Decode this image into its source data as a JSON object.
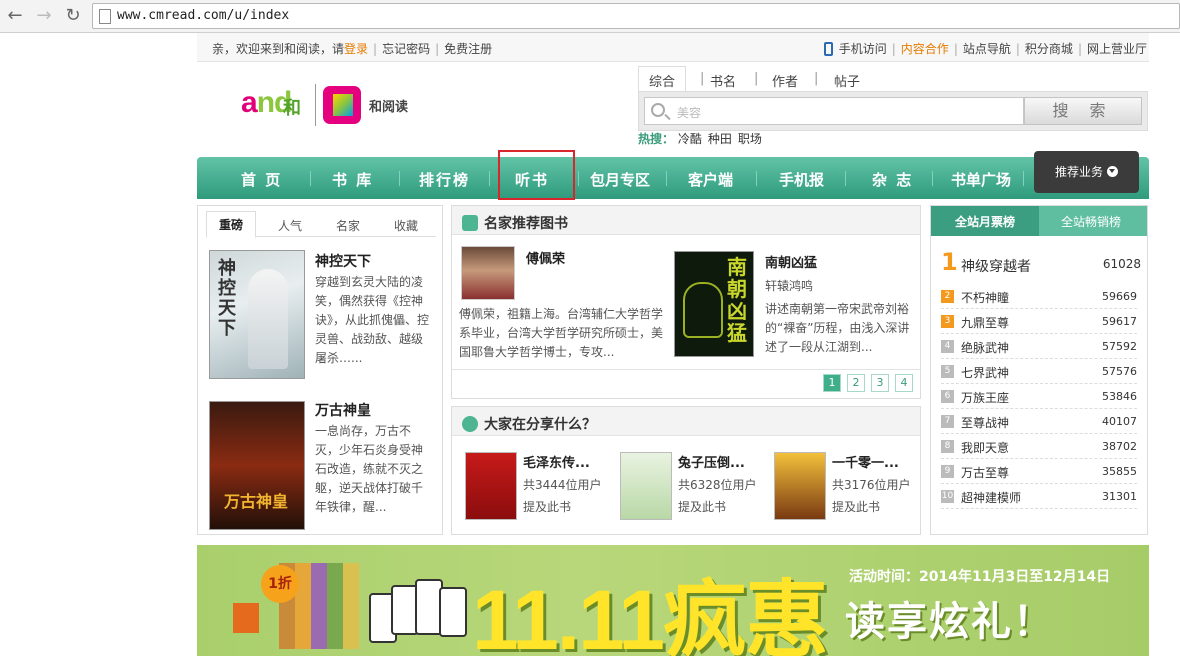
{
  "browser": {
    "url": "www.cmread.com/u/index"
  },
  "topbar": {
    "greeting": "亲，欢迎来到和阅读，请",
    "login": "登录",
    "forgot": "忘记密码",
    "register": "免费注册",
    "links": [
      "手机访问",
      "内容合作",
      "站点导航",
      "积分商城",
      "网上营业厅"
    ]
  },
  "logo": {
    "and": "and",
    "he": "和",
    "name": "和阅读"
  },
  "search": {
    "tabs": [
      "综合",
      "书名",
      "作者",
      "帖子"
    ],
    "placeholder": "美容",
    "button": "搜 索",
    "hot_label": "热搜：",
    "hot": [
      "冷酷",
      "种田",
      "职场"
    ]
  },
  "nav": {
    "items": [
      "首 页",
      "书 库",
      "排行榜",
      "听书",
      "包月专区",
      "客户端",
      "手机报",
      "杂 志",
      "书单广场"
    ],
    "recommend": "推荐业务"
  },
  "left_panel": {
    "tabs": [
      "重磅",
      "人气",
      "名家",
      "收藏"
    ],
    "books": [
      {
        "title": "神控天下",
        "desc": "穿越到玄灵大陆的凌笑，偶然获得《控神诀》，从此抓傀儡、控灵兽、战劲敌、越级屠杀…...",
        "cover_text": "神控天下"
      },
      {
        "title": "万古神皇",
        "desc": "一息尚存，万古不灭，少年石炎身受神石改造，练就不灭之躯，逆天战体打破千年铁律，醒...",
        "cover_text": "万古神皇"
      }
    ]
  },
  "authors": {
    "title": "名家推荐图书",
    "items": [
      {
        "name": "傅佩荣",
        "desc": "傅佩荣，祖籍上海。台湾辅仁大学哲学系毕业，台湾大学哲学研究所硕士，美国耶鲁大学哲学博士，专攻..."
      },
      {
        "name": "南朝凶猛",
        "sub": "轩辕鸿鸣",
        "desc": "讲述南朝第一帝宋武帝刘裕的“裸奋”历程，由浅入深讲述了一段从江湖到...",
        "cover_text": "南朝凶猛"
      }
    ],
    "pages": [
      "1",
      "2",
      "3",
      "4"
    ]
  },
  "share": {
    "title": "大家在分享什么？",
    "items": [
      {
        "title": "毛泽东传...",
        "users": "共3444位用户",
        "mention": "提及此书"
      },
      {
        "title": "兔子压倒...",
        "users": "共6328位用户",
        "mention": "提及此书"
      },
      {
        "title": "一千零一...",
        "users": "共3176位用户",
        "mention": "提及此书"
      }
    ]
  },
  "ranking": {
    "tabs": [
      "全站月票榜",
      "全站畅销榜"
    ],
    "items": [
      {
        "rank": "1",
        "title": "神级穿越者",
        "value": "61028"
      },
      {
        "rank": "2",
        "title": "不朽神瞳",
        "value": "59669"
      },
      {
        "rank": "3",
        "title": "九鼎至尊",
        "value": "59617"
      },
      {
        "rank": "4",
        "title": "绝脉武神",
        "value": "57592"
      },
      {
        "rank": "5",
        "title": "七界武神",
        "value": "57576"
      },
      {
        "rank": "6",
        "title": "万族王座",
        "value": "53846"
      },
      {
        "rank": "7",
        "title": "至尊战神",
        "value": "40107"
      },
      {
        "rank": "8",
        "title": "我即天意",
        "value": "38702"
      },
      {
        "rank": "9",
        "title": "万古至尊",
        "value": "35855"
      },
      {
        "rank": "10",
        "title": "超神建模师",
        "value": "31301"
      }
    ]
  },
  "banner": {
    "big": "11.11疯惠",
    "time": "活动时间：2014年11月3日至12月14日",
    "slogan": "读享炫礼！",
    "tag": "1折"
  },
  "colors": {
    "nav_green": "#3fae8b",
    "orange": "#e57b00",
    "highlight": "#d8262c"
  }
}
